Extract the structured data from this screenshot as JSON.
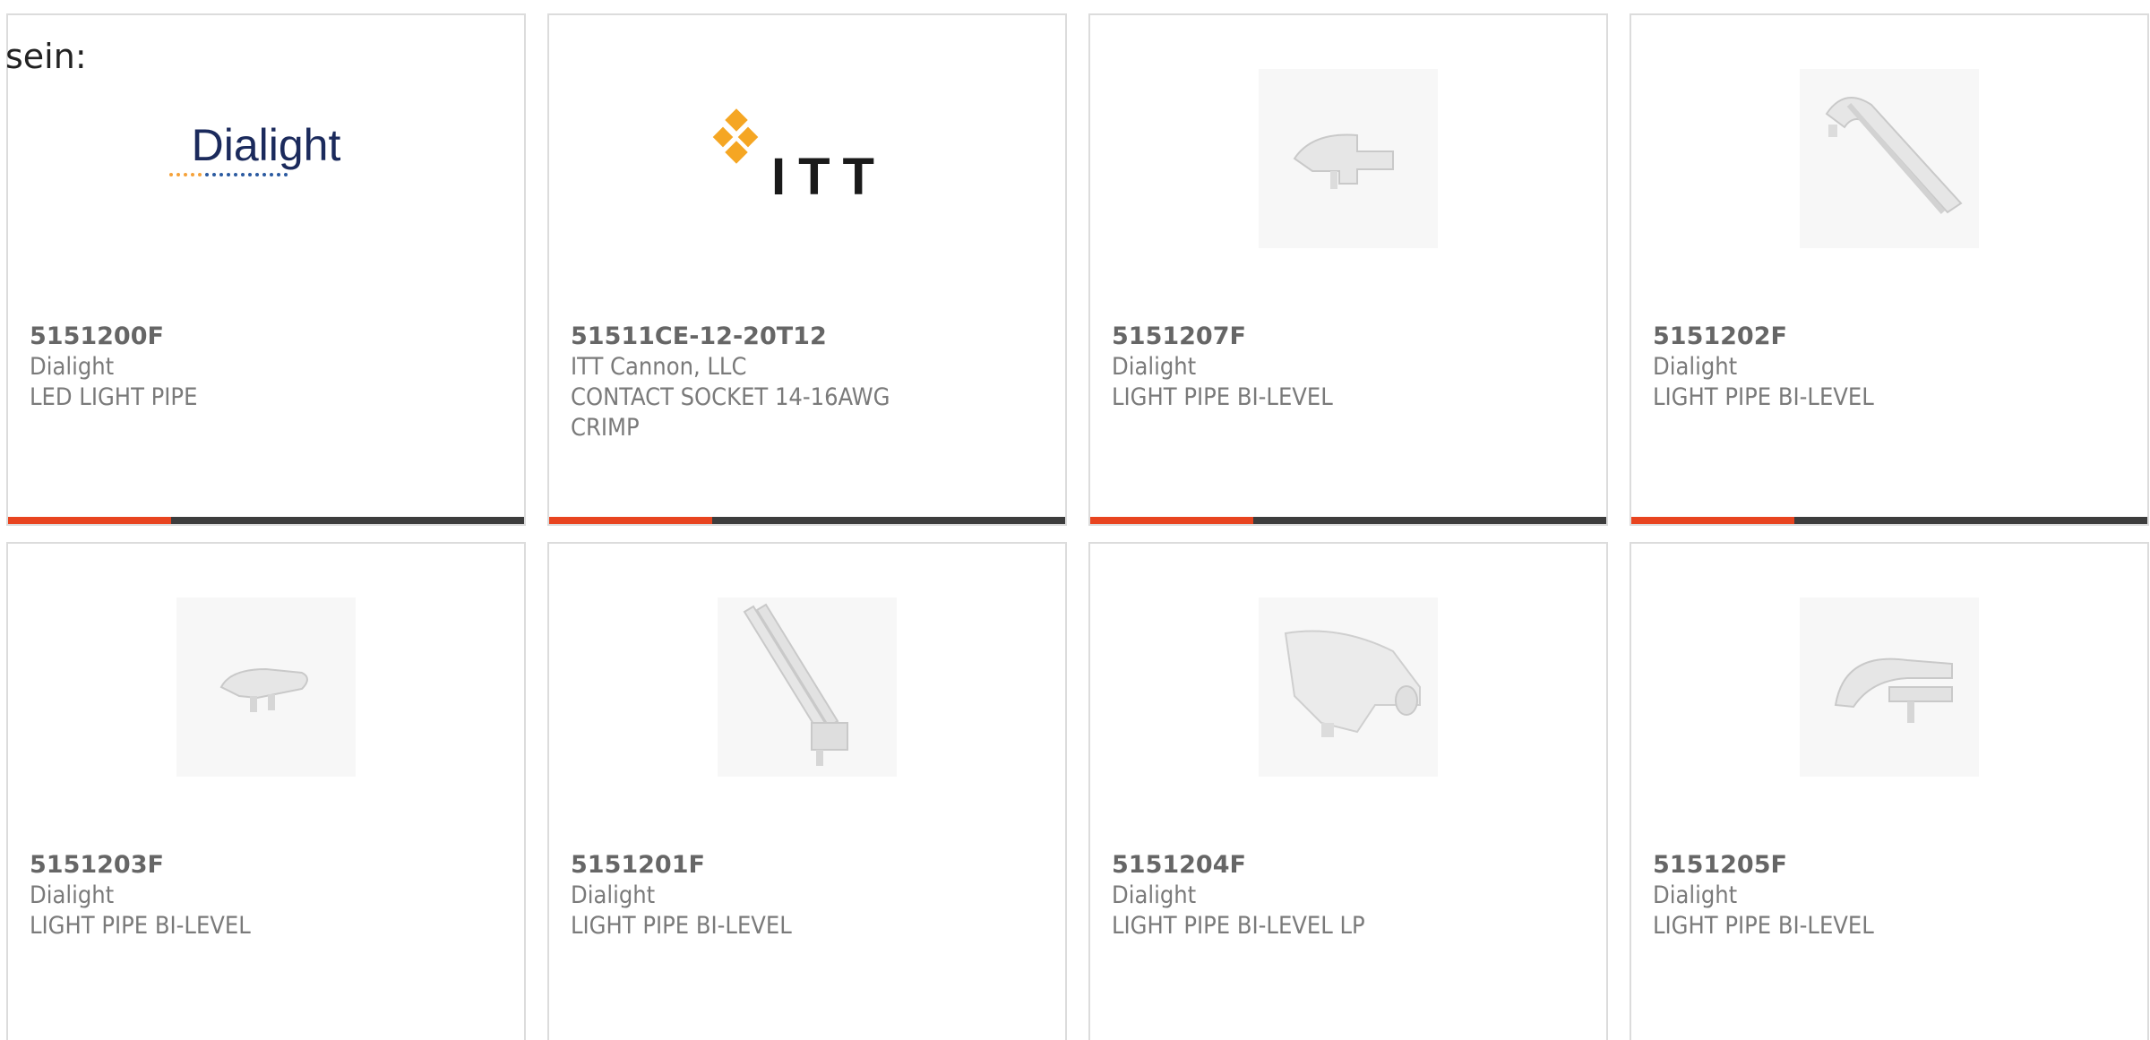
{
  "intro_text": "sein:",
  "colors": {
    "accent": "#e8441f",
    "bar": "#3d3d3d",
    "border": "#dcdcdc",
    "text": "#7a7a7a"
  },
  "logos": {
    "dialight": "Dialight",
    "itt": "ITT"
  },
  "products": [
    {
      "part": "5151200F",
      "manufacturer": "Dialight",
      "description": "LED LIGHT PIPE",
      "image": "dialight-logo"
    },
    {
      "part": "51511CE-12-20T12",
      "manufacturer": "ITT Cannon, LLC",
      "description": "CONTACT SOCKET 14-16AWG CRIMP",
      "image": "itt-logo"
    },
    {
      "part": "5151207F",
      "manufacturer": "Dialight",
      "description": "LIGHT PIPE BI-LEVEL",
      "image": "light-pipe-photo"
    },
    {
      "part": "5151202F",
      "manufacturer": "Dialight",
      "description": "LIGHT PIPE BI-LEVEL",
      "image": "light-pipe-photo"
    },
    {
      "part": "5151203F",
      "manufacturer": "Dialight",
      "description": "LIGHT PIPE BI-LEVEL",
      "image": "light-pipe-photo"
    },
    {
      "part": "5151201F",
      "manufacturer": "Dialight",
      "description": "LIGHT PIPE BI-LEVEL",
      "image": "light-pipe-photo"
    },
    {
      "part": "5151204F",
      "manufacturer": "Dialight",
      "description": "LIGHT PIPE BI-LEVEL LP",
      "image": "light-pipe-photo"
    },
    {
      "part": "5151205F",
      "manufacturer": "Dialight",
      "description": "LIGHT PIPE BI-LEVEL",
      "image": "light-pipe-photo"
    }
  ]
}
